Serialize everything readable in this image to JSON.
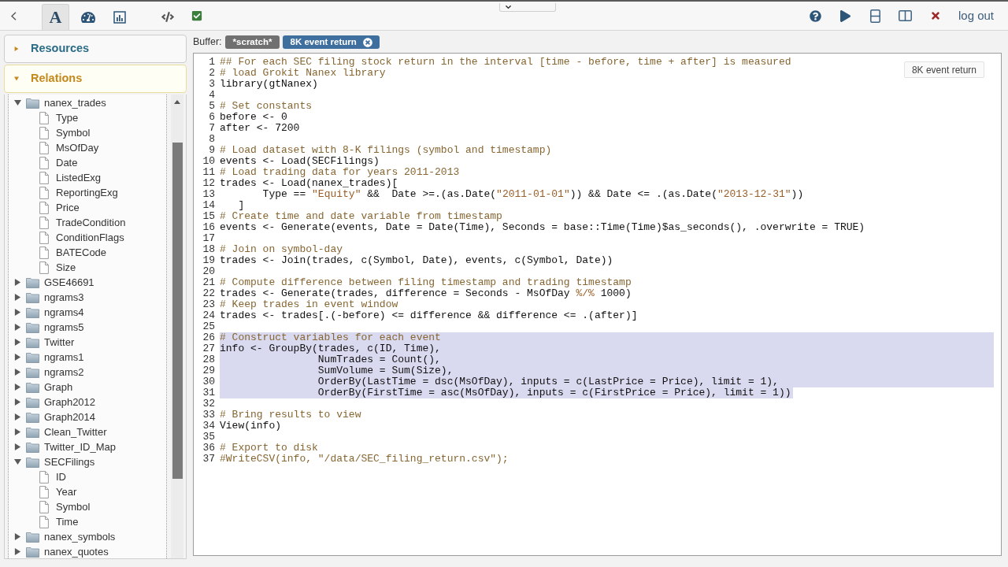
{
  "toolbar": {
    "tabs": [
      {
        "kind": "text",
        "label": "A",
        "selected": true
      },
      {
        "kind": "dashboard",
        "selected": false
      },
      {
        "kind": "chart",
        "selected": false
      },
      {
        "kind": "code",
        "selected": false
      }
    ],
    "tools": [
      {
        "kind": "check"
      }
    ],
    "actions": [
      {
        "kind": "help"
      },
      {
        "kind": "run"
      },
      {
        "kind": "split-horizontal"
      },
      {
        "kind": "split-vertical"
      },
      {
        "kind": "close"
      }
    ],
    "logout": "log out"
  },
  "sidebar": {
    "sections": [
      {
        "label": "Resources",
        "expanded": false
      },
      {
        "label": "Relations",
        "expanded": true,
        "tree": [
          {
            "kind": "folder",
            "label": "nanex_trades",
            "expanded": true,
            "children": [
              {
                "kind": "field",
                "label": "Type"
              },
              {
                "kind": "field",
                "label": "Symbol"
              },
              {
                "kind": "field",
                "label": "MsOfDay"
              },
              {
                "kind": "field",
                "label": "Date"
              },
              {
                "kind": "field",
                "label": "ListedExg"
              },
              {
                "kind": "field",
                "label": "ReportingExg"
              },
              {
                "kind": "field",
                "label": "Price"
              },
              {
                "kind": "field",
                "label": "TradeCondition"
              },
              {
                "kind": "field",
                "label": "ConditionFlags"
              },
              {
                "kind": "field",
                "label": "BATECode"
              },
              {
                "kind": "field",
                "label": "Size"
              }
            ]
          },
          {
            "kind": "folder",
            "label": "GSE46691",
            "expanded": false
          },
          {
            "kind": "folder",
            "label": "ngrams3",
            "expanded": false
          },
          {
            "kind": "folder",
            "label": "ngrams4",
            "expanded": false
          },
          {
            "kind": "folder",
            "label": "ngrams5",
            "expanded": false
          },
          {
            "kind": "folder",
            "label": "Twitter",
            "expanded": false
          },
          {
            "kind": "folder",
            "label": "ngrams1",
            "expanded": false
          },
          {
            "kind": "folder",
            "label": "ngrams2",
            "expanded": false
          },
          {
            "kind": "folder",
            "label": "Graph",
            "expanded": false
          },
          {
            "kind": "folder",
            "label": "Graph2012",
            "expanded": false
          },
          {
            "kind": "folder",
            "label": "Graph2014",
            "expanded": false
          },
          {
            "kind": "folder",
            "label": "Clean_Twitter",
            "expanded": false
          },
          {
            "kind": "folder",
            "label": "Twitter_ID_Map",
            "expanded": false
          },
          {
            "kind": "folder",
            "label": "SECFilings",
            "expanded": true,
            "children": [
              {
                "kind": "field",
                "label": "ID"
              },
              {
                "kind": "field",
                "label": "Year"
              },
              {
                "kind": "field",
                "label": "Symbol"
              },
              {
                "kind": "field",
                "label": "Time"
              }
            ]
          },
          {
            "kind": "folder",
            "label": "nanex_symbols",
            "expanded": false
          },
          {
            "kind": "folder",
            "label": "nanex_quotes",
            "expanded": false
          }
        ]
      }
    ]
  },
  "buffer": {
    "label": "Buffer:",
    "tabs": [
      {
        "label": "*scratch*",
        "selected": false,
        "closable": false
      },
      {
        "label": "8K event return",
        "selected": true,
        "closable": true
      }
    ]
  },
  "editor": {
    "badge": "8K event return",
    "lines": [
      {
        "number": "1",
        "selected": false,
        "segments": [
          {
            "kind": "comment",
            "text": "## For each SEC filing stock return in the interval [time - before, time + after] is measured"
          }
        ]
      },
      {
        "number": "2",
        "selected": false,
        "segments": [
          {
            "kind": "comment",
            "text": "# load Grokit Nanex library"
          }
        ]
      },
      {
        "number": "3",
        "selected": false,
        "segments": [
          {
            "kind": "plain",
            "text": "library(gtNanex)"
          }
        ]
      },
      {
        "number": "4",
        "selected": false
      },
      {
        "number": "5",
        "selected": false,
        "segments": [
          {
            "kind": "comment",
            "text": "# Set constants"
          }
        ]
      },
      {
        "number": "6",
        "selected": false,
        "segments": [
          {
            "kind": "plain",
            "text": "before <- 0"
          }
        ]
      },
      {
        "number": "7",
        "selected": false,
        "segments": [
          {
            "kind": "plain",
            "text": "after <- 7200"
          }
        ]
      },
      {
        "number": "8",
        "selected": false
      },
      {
        "number": "9",
        "selected": false,
        "segments": [
          {
            "kind": "comment",
            "text": "# Load dataset with 8-K filings (symbol and timestamp)"
          }
        ]
      },
      {
        "number": "10",
        "selected": false,
        "segments": [
          {
            "kind": "plain",
            "text": "events <- Load(SECFilings)"
          }
        ]
      },
      {
        "number": "11",
        "selected": false,
        "segments": [
          {
            "kind": "comment",
            "text": "# Load trading data for years 2011-2013"
          }
        ]
      },
      {
        "number": "12",
        "selected": false,
        "segments": [
          {
            "kind": "plain",
            "text": "trades <- Load(nanex_trades)["
          }
        ]
      },
      {
        "number": "13",
        "selected": false,
        "segments": [
          {
            "kind": "plain",
            "text": "       Type == "
          },
          {
            "kind": "string",
            "text": "\"Equity\""
          },
          {
            "kind": "plain",
            "text": " &&  Date >=.(as.Date("
          },
          {
            "kind": "string",
            "text": "\"2011-01-01\""
          },
          {
            "kind": "plain",
            "text": ")) && Date <= .(as.Date("
          },
          {
            "kind": "string",
            "text": "\"2013-12-31\""
          },
          {
            "kind": "plain",
            "text": "))"
          }
        ]
      },
      {
        "number": "14",
        "selected": false,
        "segments": [
          {
            "kind": "plain",
            "text": "   ]"
          }
        ]
      },
      {
        "number": "15",
        "selected": false,
        "segments": [
          {
            "kind": "comment",
            "text": "# Create time and date variable from timestamp"
          }
        ]
      },
      {
        "number": "16",
        "selected": false,
        "segments": [
          {
            "kind": "plain",
            "text": "events <- Generate(events, Date = Date(Time), Seconds = base::Time(Time)$as_seconds(), .overwrite = TRUE)"
          }
        ]
      },
      {
        "number": "17",
        "selected": false
      },
      {
        "number": "18",
        "selected": false,
        "segments": [
          {
            "kind": "comment",
            "text": "# Join on symbol-day"
          }
        ]
      },
      {
        "number": "19",
        "selected": false,
        "segments": [
          {
            "kind": "plain",
            "text": "trades <- Join(trades, c(Symbol, Date), events, c(Symbol, Date))"
          }
        ]
      },
      {
        "number": "20",
        "selected": false
      },
      {
        "number": "21",
        "selected": false,
        "segments": [
          {
            "kind": "comment",
            "text": "# Compute difference between filing timestamp and trading timestamp"
          }
        ]
      },
      {
        "number": "22",
        "selected": false,
        "segments": [
          {
            "kind": "plain",
            "text": "trades <- Generate(trades, difference = Seconds - MsOfDay "
          },
          {
            "kind": "operator",
            "text": "%/%"
          },
          {
            "kind": "plain",
            "text": " 1000)"
          }
        ]
      },
      {
        "number": "23",
        "selected": false,
        "segments": [
          {
            "kind": "comment",
            "text": "# Keep trades in event window"
          }
        ]
      },
      {
        "number": "24",
        "selected": false,
        "segments": [
          {
            "kind": "plain",
            "text": "trades <- trades[.(-before) <= difference && difference <= .(after)]"
          }
        ]
      },
      {
        "number": "25",
        "selected": false
      },
      {
        "number": "26",
        "selected": true,
        "segments": [
          {
            "kind": "comment",
            "text": "# Construct variables for each event"
          }
        ]
      },
      {
        "number": "27",
        "selected": true,
        "segments": [
          {
            "kind": "plain",
            "text": "info <- GroupBy(trades, c(ID, Time),"
          }
        ]
      },
      {
        "number": "28",
        "selected": true,
        "segments": [
          {
            "kind": "plain",
            "text": "                NumTrades = Count(),"
          }
        ]
      },
      {
        "number": "29",
        "selected": true,
        "segments": [
          {
            "kind": "plain",
            "text": "                SumVolume = Sum(Size),"
          }
        ]
      },
      {
        "number": "30",
        "selected": true,
        "segments": [
          {
            "kind": "plain",
            "text": "                OrderBy(LastTime = dsc(MsOfDay), inputs = c(LastPrice = Price), limit = 1),"
          }
        ]
      },
      {
        "number": "31",
        "selected": true,
        "segments": [
          {
            "kind": "plain",
            "text": "                OrderBy(FirstTime = asc(MsOfDay), inputs = c(FirstPrice = Price), limit = 1))"
          }
        ]
      },
      {
        "number": "32",
        "selected": false
      },
      {
        "number": "33",
        "selected": false,
        "segments": [
          {
            "kind": "comment",
            "text": "# Bring results to view"
          }
        ]
      },
      {
        "number": "34",
        "selected": false,
        "segments": [
          {
            "kind": "plain",
            "text": "View(info)"
          }
        ]
      },
      {
        "number": "35",
        "selected": false
      },
      {
        "number": "36",
        "selected": false,
        "segments": [
          {
            "kind": "comment",
            "text": "# Export to disk"
          }
        ]
      },
      {
        "number": "37",
        "selected": false,
        "segments": [
          {
            "kind": "comment",
            "text": "#WriteCSV(info, \"/data/SEC_filing_return.csv\");"
          }
        ]
      }
    ]
  }
}
